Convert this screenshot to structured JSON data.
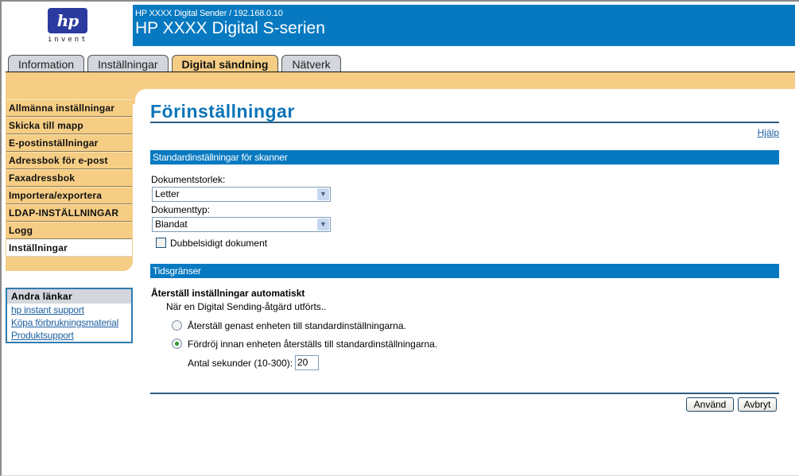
{
  "logo": {
    "mark": "hp",
    "tagline": "invent"
  },
  "header": {
    "subtitle": "HP XXXX Digital Sender / 192.168.0.10",
    "title": "HP XXXX Digital S-serien"
  },
  "tabs": [
    {
      "label": "Information",
      "active": false
    },
    {
      "label": "Inställningar",
      "active": false
    },
    {
      "label": "Digital sändning",
      "active": true
    },
    {
      "label": "Nätverk",
      "active": false
    }
  ],
  "sidebar": {
    "items": [
      {
        "label": "Allmänna inställningar",
        "active": false
      },
      {
        "label": "Skicka till mapp",
        "active": false
      },
      {
        "label": "E-postinställningar",
        "active": false
      },
      {
        "label": "Adressbok för e-post",
        "active": false
      },
      {
        "label": "Faxadressbok",
        "active": false
      },
      {
        "label": "Importera/exportera",
        "active": false
      },
      {
        "label": "LDAP-INSTÄLLNINGAR",
        "active": false
      },
      {
        "label": "Logg",
        "active": false
      },
      {
        "label": "Inställningar",
        "active": true
      }
    ]
  },
  "other_links": {
    "heading": "Andra länkar",
    "links": [
      "hp instant support",
      "Köpa förbrukningsmaterial",
      "Produktsupport"
    ]
  },
  "main": {
    "title": "Förinställningar",
    "help_link": "Hjälp",
    "scanner_section": {
      "heading": "Standardinställningar för skanner",
      "doc_size_label": "Dokumentstorlek:",
      "doc_size_value": "Letter",
      "doc_type_label": "Dokumenttyp:",
      "doc_type_value": "Blandat",
      "duplex_label": "Dubbelsidigt dokument",
      "duplex_checked": false
    },
    "timeout_section": {
      "heading": "Tidsgränser",
      "subheading": "Återställ inställningar automatiskt",
      "description": "När en Digital Sending-åtgärd utförts..",
      "options": [
        {
          "label": "Återställ genast enheten till standardinställningarna.",
          "checked": false
        },
        {
          "label": "Fördröj innan enheten återställs till standardinställningarna.",
          "checked": true
        }
      ],
      "seconds_label": "Antal sekunder (10-300):",
      "seconds_value": "20"
    },
    "buttons": {
      "apply": "Använd",
      "cancel": "Avbryt"
    }
  },
  "colors": {
    "brand_blue": "#0779c1",
    "tab_accent": "#f5cd85",
    "link": "#1e5fa0"
  }
}
